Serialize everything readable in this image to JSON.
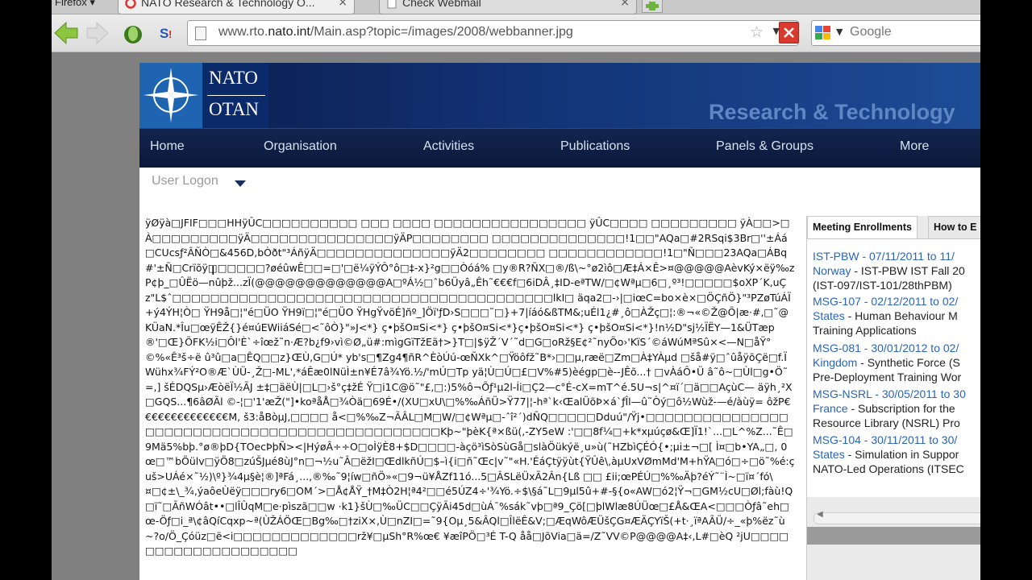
{
  "browser": {
    "menu_label": "Firefox ▾",
    "tabs": [
      {
        "title": "NATO Research & Technology O...",
        "close": "×"
      },
      {
        "title": "Check Webmail",
        "close": "×"
      }
    ],
    "url": {
      "prefix": "www.rto.",
      "domain": "nato.int",
      "path": "/Main.asp?topic=/images/2008/webbanner.jpg"
    },
    "search_engine": "Google"
  },
  "site": {
    "logo": {
      "line1": "NATO",
      "line2": "OTAN"
    },
    "banner_text": "Research & Technology",
    "nav": [
      "Home",
      "Organisation",
      "Activities",
      "Publications",
      "Panels & Groups",
      "More"
    ],
    "user_logon": "User Logon",
    "garbled_text": "ÿØÿà□JFIF□□□HHÿÛC□□□□□□□□□□ □□□ □□□□  □□□□□□□□□□□□□□□□ ÿÛC□□□□  □□□□□□□□□ ÿÀ□□>□À□□□□□□□□□ÿÄ□□□□□□□□□□□□□□□ÿÄP□□□□□□□□ □□□□□□□□□□□□□□!1□□\"AQa□#2RSqi$3Br□''±Áá□CUcsƒ²ÂÑÒ□&456D,bÒðt\"³ÁñÿÄ□□□□□□□□□□□□□□ÿÄ2□□□□□□□□ □□□□□□□□□□□□!1□\"Ñ□□□23AQa□ÁBq#'±Ñ□Crïõÿ□□□□□□?øéûwÊ□□=□'□ë¼ÿÝÔ°ô□‡-x}²g□□Òóá% □y®R?ÑX□®/ß\\~°ø2ìô□Æ‡Á×Ê>¤@@@@@AèvKý×ëÿ‰zP¢þ_□ÛËö—nûþž...zÏ(@@@@@@@@@@@@@A□ºÁ½□ˆb6Üyâ„Êh˜€€€f□6iDÂ¸‡ID-eªTW/□¢Wªµ□6□¸º³!□□□□□$oXP´K,uÇz\"L$ˆ□□□□□□□□□□□□□□□□□□□□□□□□□□□□□□□□□□□□□□□□lkI□ äqa2□-›|□iœC=bo×è×□ÖÇñÖ}\"³PZøTúÁÏ+ý4ÝH¦Ò□ ŸH9å□¦\"é□ÜO ŸH9ï□¦\"é□ÜO ŸHgŸvöÉ]ñº_]Öï'ƒD›S□□□˜□}+7|íáó&ßTM&;uÉl1¿#¸ô□ÀŽç□¦:®¬«©Ž@Õ|æ·#,□˜@KÜaN.*Îu□œÿÊŽ{}é¤úEWiiáSé□<˜ôÒ}\"»J<*} ç•þšO¤Si<*} ç•þšO¤Si<*}ç•þšO¤Si<*} ç•þšO¤Si<*}!n½D\"sj½ÏËY—1&ÜTæp®'□Œ}ÕFK½i□Ôl'È`÷îœž˜n·Æ?b¿f9›vì©Ø„ü#:mìgGïTžEä†>}T□|$ÿŽ´V´˜d□G□oRž§E¢²˜nyÕo›'KïS´©áWúMªSû×<—N□åŸ°©%«Ê³š÷ë û³û□a□ÊQ□□z}ŒÙ,G□Ú* yb's□¶Zg4¶ñR^ÈòÚú-œÑXk^□Ÿöôfž˜B*›□□µ,ræë□Zm□À‡YÀµd □šå#ÿ□ˆûåÿõÇë□f.ÏWühx¾FÝ²O®Æ`ÙÜ-¸Ž□-ML',*áÊæ0lNüÌ±n¥É7â¾Yö.½/'mÚ□Tp yä¦Ù□Ú□£□V%#5)èégp□è--JÊõ...† □vÀáÔ•Ü â˜ô~□Ùl□g•Ö˜=,] šÉDQSµ›ÆòëÏ½ÃJ ±‡□äëÙ|□L□›š°ç‡žÉ Ÿ□i1C@ö˜\"£,□:)5%ô¬Õƒ¹µ2l-Íi□Ç2—c°É-cX=mT^é.5U¬s|^¤ï´□ä□□AçùC— äÿh¸²X□GQS...¶6âØÃl ©-¦□'1'æŽ(\"]•koªåÅ□¾Òä□69É•/(XU□xU\\□%‰ÁñÜ>Ÿ77|¦-hª`k‹ŒalÜõÞ×á`ƒÎl—û˜Òý□ô½Wùž-—é/àùÿ= ôžP€€€€€€€€€€€€€€M, š3:åBòµJ,□□□□ å<□%‰Z¬ÃÂL□M□W/□¢Wªµ□-ˆî²´)dÑQ□□□□□Dduú\"/Ÿj•□□□□□□□□□□□□□□□□□□□□□□□□□□□□□□□□□□□□□□□□□□□□□□Kþ~\"þèK{ª×ßü(,-ZY5eW :'□□8f¼□+k*xµúçø&Œ]Ï1!`...□L^%Z...˜Ê□9Mä5%bþ.°ø®þD{TOecÞþÑ><|HýøÂ÷÷O□oÌÿÈ8+$D□□□□-àçö³ìSòSùGå□slàÖükýë¸u»ù(˜HZbìÇÉÓ{•;µi±¬□[ Ì¤□b•YA„□, 0œ□™bÖülv□ÿÖ8□zúŠJµé8ùJ°n□¬½u˜Â□ëžI□ŒdlkñÚ□$–ì{i□ñ˜Œc|v˜\"«H.'ÉáÇtÿÿùt{ŸÛê\\,àµUxVØmMd'M+hŸA□ó□÷□ö˜%é:çuš>UÁé×˜½)\\º}¾4µ§è¦®]ªFá¸...,®‰˜9¦íw□ñÖ»«□9¬ü¥ÅZf11ó...5□ÂSLëÜxÃ2Ân{Lß □□ £ii;œPÉÚ□%‰Äþ?éÝ˜¨Ì~□ï¤´fó\\¤□¢±\\_¾‚ýaôeÙëÿ□□□ry6□OM´>□Å¢ÅŸ_†M‡Ò2H¦ª4²□□é5ÚZ4÷'¾Yö.÷$\\§á˜L□9µl5û+#-§{o«AW□ó2¦Ÿ¬□GM½cU□Øl;fàù!Q□ï˜□ÃñWÓât••□lÎÛqM□e·pìszã□□w ·k1}šÙ□‰ÜC□□ÇÿÃi45d□ùÁ¯%sák˜vþ□ª9_Çö[□þlWlæ8ÚÜœ□£Å&ŒA<□□□Òƒâ˜eh□œ-Öƒ□i_ª\\¢âQíCqxp~ª(ÙŽÁÖŒ□Bg‰□†ziX×,Ù□nZI□=˜9{Oµ¸5&ÂQl□ÎlëÊ&V;□ÆqWôÆÜšÇG¤ÆÄÇYïŠ(+t·¸ïªAÃÜ/÷_«þ%ëz˜ù~?o/Ö_Çóüz□ë<i□□□□□□□□□□□□□rž¥□µSh°R%œ€ ¥æîPÖ□³É T-Q åå□JõVia□ä=/Z˜VV©P@@@@A‡‹,L#□èQ ²jU□□□□□□□□□□□□□□□□□□□□"
  },
  "sidebar": {
    "tabs": [
      "Meeting Enrollments",
      "How to E"
    ],
    "items": [
      {
        "l1_link": "IST-PBW - 07/11/2011 to 11/",
        "l2_link": "Norway",
        "l2_text": " - IST-PBW IST Fall 20",
        "l3_text": "(IST-097/IST-101/28thPBM)"
      },
      {
        "l1_link": "MSG-107 - 02/12/2011 to 02/",
        "l2_link": "States",
        "l2_text": " - Human Behaviour M",
        "l3_text": "Training Applications"
      },
      {
        "l1_link": "MSG-081 - 30/01/2012 to 02/",
        "l2_link": "Kingdom",
        "l2_text": " - Synthetic Force (S",
        "l3_text": "Pre-Deployment Training Wor"
      },
      {
        "l1_link": "MSG-NSRL - 30/05/2011 to 30",
        "l2_link": "France",
        "l2_text": " - Subscription for the",
        "l3_text": "Resource Library (NSRL) Pro"
      },
      {
        "l1_link": "MSG-104 - 30/11/2011 to 30/",
        "l2_link": "States",
        "l2_text": " - Simulation in Suppor",
        "l3_text": "NATO-Led Operations (ITSEC"
      }
    ]
  },
  "colors": {
    "nav_bg": "#13254f",
    "link": "#2a64b8",
    "banner": "#123275"
  }
}
